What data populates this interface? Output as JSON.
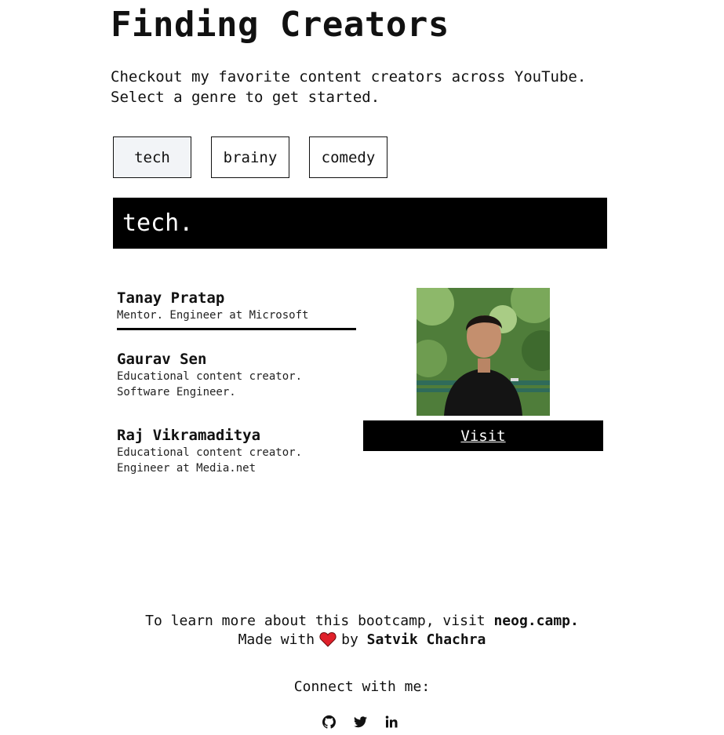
{
  "page": {
    "title": "Finding Creators",
    "intro_line1": "Checkout my favorite content creators across YouTube.",
    "intro_line2": "Select a genre to get started."
  },
  "genres": {
    "tech": "tech",
    "brainy": "brainy",
    "comedy": "comedy",
    "selected": "tech"
  },
  "section": {
    "heading": "tech."
  },
  "creators": [
    {
      "name": "Tanay Pratap",
      "desc_line1": "Mentor. Engineer at Microsoft",
      "desc_line2": ""
    },
    {
      "name": "Gaurav Sen",
      "desc_line1": "Educational content creator.",
      "desc_line2": "Software Engineer."
    },
    {
      "name": "Raj Vikramaditya",
      "desc_line1": "Educational content creator.",
      "desc_line2": "Engineer at Media.net"
    }
  ],
  "selected_creator": {
    "visit_label": "Visit"
  },
  "footer": {
    "learn_prefix": "To learn more about this bootcamp, visit ",
    "learn_link": "neog.camp.",
    "made_prefix": "Made with",
    "made_by": "by",
    "author": "Satvik Chachra",
    "connect": "Connect with me:"
  },
  "icons": {
    "github": "github-icon",
    "twitter": "twitter-icon",
    "linkedin": "linkedin-icon",
    "heart": "heart-icon"
  },
  "colors": {
    "accent": "#000000",
    "active_button_bg": "#f2f4f7",
    "heart": "#e0202a"
  }
}
